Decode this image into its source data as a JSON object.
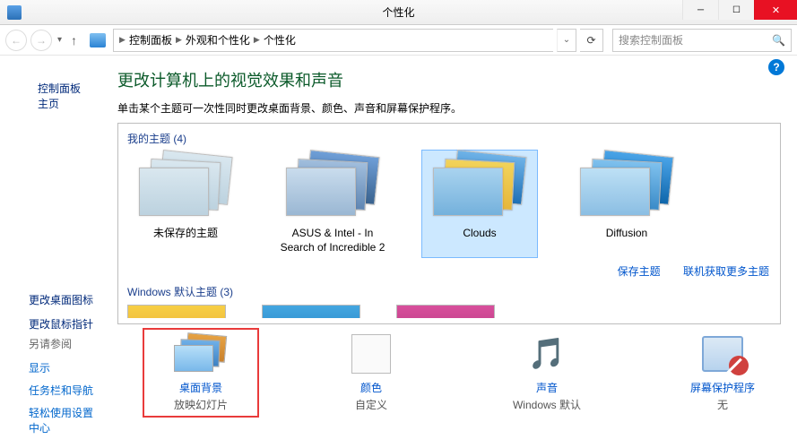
{
  "window": {
    "title": "个性化"
  },
  "nav": {
    "crumbs": [
      "控制面板",
      "外观和个性化",
      "个性化"
    ],
    "search_placeholder": "搜索控制面板"
  },
  "sidebar": {
    "links": [
      "控制面板主页",
      "更改桌面图标",
      "更改鼠标指针"
    ],
    "see_also_label": "另请参阅",
    "see_also": [
      "显示",
      "任务栏和导航",
      "轻松使用设置中心"
    ]
  },
  "main": {
    "heading": "更改计算机上的视觉效果和声音",
    "desc": "单击某个主题可一次性同时更改桌面背景、颜色、声音和屏幕保护程序。",
    "group_my_themes": "我的主题 (4)",
    "group_win_themes": "Windows 默认主题 (3)",
    "themes": [
      {
        "name": "未保存的主题",
        "cls": "th-unsaved"
      },
      {
        "name": "ASUS & Intel - In Search of Incredible 2",
        "cls": "th-asus"
      },
      {
        "name": "Clouds",
        "cls": "th-clouds",
        "selected": true
      },
      {
        "name": "Diffusion",
        "cls": "th-diff"
      }
    ],
    "link_save": "保存主题",
    "link_more": "联机获取更多主题"
  },
  "settings": [
    {
      "name": "桌面背景",
      "value": "放映幻灯片",
      "highlight": true,
      "kind": "bg"
    },
    {
      "name": "颜色",
      "value": "自定义",
      "kind": "color"
    },
    {
      "name": "声音",
      "value": "Windows 默认",
      "kind": "sound"
    },
    {
      "name": "屏幕保护程序",
      "value": "无",
      "kind": "saver"
    }
  ]
}
